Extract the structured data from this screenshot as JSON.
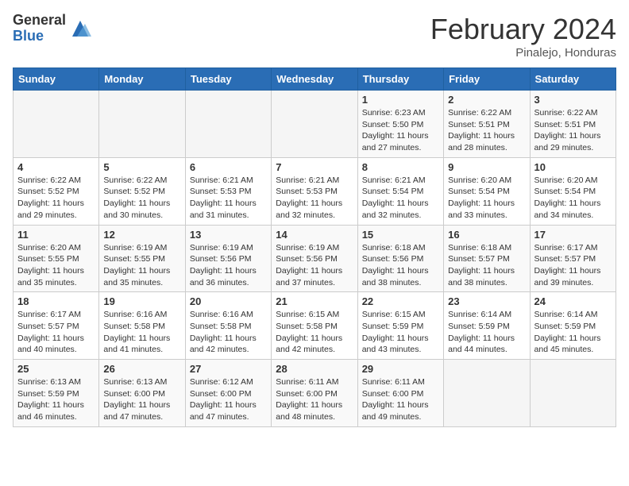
{
  "header": {
    "logo_general": "General",
    "logo_blue": "Blue",
    "month_title": "February 2024",
    "subtitle": "Pinalejo, Honduras"
  },
  "days_of_week": [
    "Sunday",
    "Monday",
    "Tuesday",
    "Wednesday",
    "Thursday",
    "Friday",
    "Saturday"
  ],
  "weeks": [
    [
      {
        "day": "",
        "info": ""
      },
      {
        "day": "",
        "info": ""
      },
      {
        "day": "",
        "info": ""
      },
      {
        "day": "",
        "info": ""
      },
      {
        "day": "1",
        "info": "Sunrise: 6:23 AM\nSunset: 5:50 PM\nDaylight: 11 hours and 27 minutes."
      },
      {
        "day": "2",
        "info": "Sunrise: 6:22 AM\nSunset: 5:51 PM\nDaylight: 11 hours and 28 minutes."
      },
      {
        "day": "3",
        "info": "Sunrise: 6:22 AM\nSunset: 5:51 PM\nDaylight: 11 hours and 29 minutes."
      }
    ],
    [
      {
        "day": "4",
        "info": "Sunrise: 6:22 AM\nSunset: 5:52 PM\nDaylight: 11 hours and 29 minutes."
      },
      {
        "day": "5",
        "info": "Sunrise: 6:22 AM\nSunset: 5:52 PM\nDaylight: 11 hours and 30 minutes."
      },
      {
        "day": "6",
        "info": "Sunrise: 6:21 AM\nSunset: 5:53 PM\nDaylight: 11 hours and 31 minutes."
      },
      {
        "day": "7",
        "info": "Sunrise: 6:21 AM\nSunset: 5:53 PM\nDaylight: 11 hours and 32 minutes."
      },
      {
        "day": "8",
        "info": "Sunrise: 6:21 AM\nSunset: 5:54 PM\nDaylight: 11 hours and 32 minutes."
      },
      {
        "day": "9",
        "info": "Sunrise: 6:20 AM\nSunset: 5:54 PM\nDaylight: 11 hours and 33 minutes."
      },
      {
        "day": "10",
        "info": "Sunrise: 6:20 AM\nSunset: 5:54 PM\nDaylight: 11 hours and 34 minutes."
      }
    ],
    [
      {
        "day": "11",
        "info": "Sunrise: 6:20 AM\nSunset: 5:55 PM\nDaylight: 11 hours and 35 minutes."
      },
      {
        "day": "12",
        "info": "Sunrise: 6:19 AM\nSunset: 5:55 PM\nDaylight: 11 hours and 35 minutes."
      },
      {
        "day": "13",
        "info": "Sunrise: 6:19 AM\nSunset: 5:56 PM\nDaylight: 11 hours and 36 minutes."
      },
      {
        "day": "14",
        "info": "Sunrise: 6:19 AM\nSunset: 5:56 PM\nDaylight: 11 hours and 37 minutes."
      },
      {
        "day": "15",
        "info": "Sunrise: 6:18 AM\nSunset: 5:56 PM\nDaylight: 11 hours and 38 minutes."
      },
      {
        "day": "16",
        "info": "Sunrise: 6:18 AM\nSunset: 5:57 PM\nDaylight: 11 hours and 38 minutes."
      },
      {
        "day": "17",
        "info": "Sunrise: 6:17 AM\nSunset: 5:57 PM\nDaylight: 11 hours and 39 minutes."
      }
    ],
    [
      {
        "day": "18",
        "info": "Sunrise: 6:17 AM\nSunset: 5:57 PM\nDaylight: 11 hours and 40 minutes."
      },
      {
        "day": "19",
        "info": "Sunrise: 6:16 AM\nSunset: 5:58 PM\nDaylight: 11 hours and 41 minutes."
      },
      {
        "day": "20",
        "info": "Sunrise: 6:16 AM\nSunset: 5:58 PM\nDaylight: 11 hours and 42 minutes."
      },
      {
        "day": "21",
        "info": "Sunrise: 6:15 AM\nSunset: 5:58 PM\nDaylight: 11 hours and 42 minutes."
      },
      {
        "day": "22",
        "info": "Sunrise: 6:15 AM\nSunset: 5:59 PM\nDaylight: 11 hours and 43 minutes."
      },
      {
        "day": "23",
        "info": "Sunrise: 6:14 AM\nSunset: 5:59 PM\nDaylight: 11 hours and 44 minutes."
      },
      {
        "day": "24",
        "info": "Sunrise: 6:14 AM\nSunset: 5:59 PM\nDaylight: 11 hours and 45 minutes."
      }
    ],
    [
      {
        "day": "25",
        "info": "Sunrise: 6:13 AM\nSunset: 5:59 PM\nDaylight: 11 hours and 46 minutes."
      },
      {
        "day": "26",
        "info": "Sunrise: 6:13 AM\nSunset: 6:00 PM\nDaylight: 11 hours and 47 minutes."
      },
      {
        "day": "27",
        "info": "Sunrise: 6:12 AM\nSunset: 6:00 PM\nDaylight: 11 hours and 47 minutes."
      },
      {
        "day": "28",
        "info": "Sunrise: 6:11 AM\nSunset: 6:00 PM\nDaylight: 11 hours and 48 minutes."
      },
      {
        "day": "29",
        "info": "Sunrise: 6:11 AM\nSunset: 6:00 PM\nDaylight: 11 hours and 49 minutes."
      },
      {
        "day": "",
        "info": ""
      },
      {
        "day": "",
        "info": ""
      }
    ]
  ]
}
